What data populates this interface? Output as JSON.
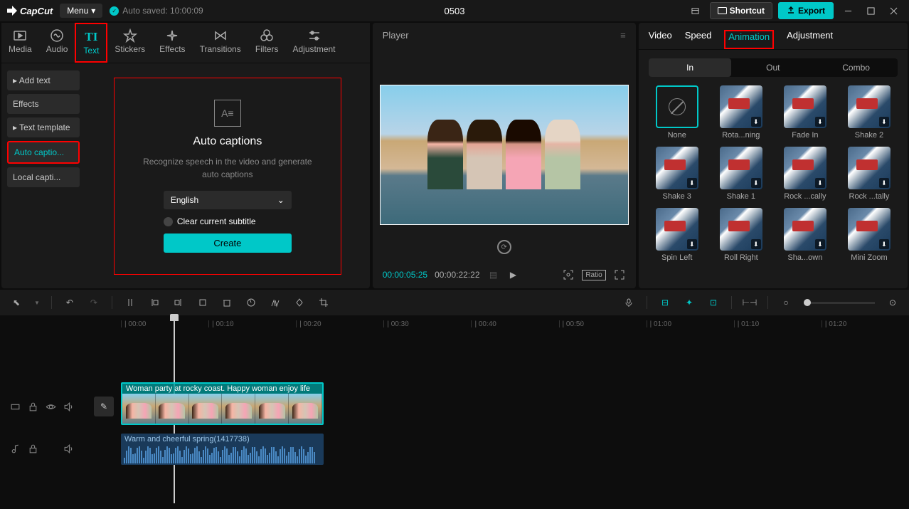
{
  "app": {
    "name": "CapCut",
    "menu_label": "Menu",
    "autosaved": "Auto saved: 10:00:09",
    "project": "0503",
    "shortcut": "Shortcut",
    "export": "Export"
  },
  "tool_tabs": [
    {
      "label": "Media",
      "icon": "play-rect"
    },
    {
      "label": "Audio",
      "icon": "audio-wave"
    },
    {
      "label": "Text",
      "icon": "text-TI",
      "active": true
    },
    {
      "label": "Stickers",
      "icon": "star"
    },
    {
      "label": "Effects",
      "icon": "sparkle"
    },
    {
      "label": "Transitions",
      "icon": "bowtie"
    },
    {
      "label": "Filters",
      "icon": "tri-circle"
    },
    {
      "label": "Adjustment",
      "icon": "sliders"
    }
  ],
  "text_sidebar": [
    {
      "label": "Add text",
      "chevron": true
    },
    {
      "label": "Effects"
    },
    {
      "label": "Text template",
      "chevron": true
    },
    {
      "label": "Auto captio...",
      "active": true
    },
    {
      "label": "Local capti..."
    }
  ],
  "auto_captions": {
    "title": "Auto captions",
    "desc": "Recognize speech in the video and generate auto captions",
    "language": "English",
    "clear_label": "Clear current subtitle",
    "create": "Create"
  },
  "player": {
    "title": "Player",
    "time_current": "00:00:05:25",
    "time_total": "00:00:22:22",
    "ratio": "Ratio"
  },
  "right": {
    "tabs": [
      "Video",
      "Speed",
      "Animation",
      "Adjustment"
    ],
    "active_tab": "Animation",
    "subtabs": [
      "In",
      "Out",
      "Combo"
    ],
    "active_subtab": "In",
    "animations": [
      {
        "label": "None",
        "none": true
      },
      {
        "label": "Rota...ning"
      },
      {
        "label": "Fade In"
      },
      {
        "label": "Shake 2"
      },
      {
        "label": "Shake 3"
      },
      {
        "label": "Shake 1"
      },
      {
        "label": "Rock ...cally"
      },
      {
        "label": "Rock ...tally"
      },
      {
        "label": "Spin Left"
      },
      {
        "label": "Roll Right"
      },
      {
        "label": "Sha...own"
      },
      {
        "label": "Mini Zoom"
      }
    ]
  },
  "timeline": {
    "ticks": [
      "00:00",
      "00:10",
      "00:20",
      "00:30",
      "00:40",
      "00:50",
      "01:00",
      "01:10",
      "01:20"
    ],
    "video_clip": "Woman party at rocky coast. Happy woman enjoy life",
    "audio_clip": "Warm and cheerful spring(1417738)"
  }
}
